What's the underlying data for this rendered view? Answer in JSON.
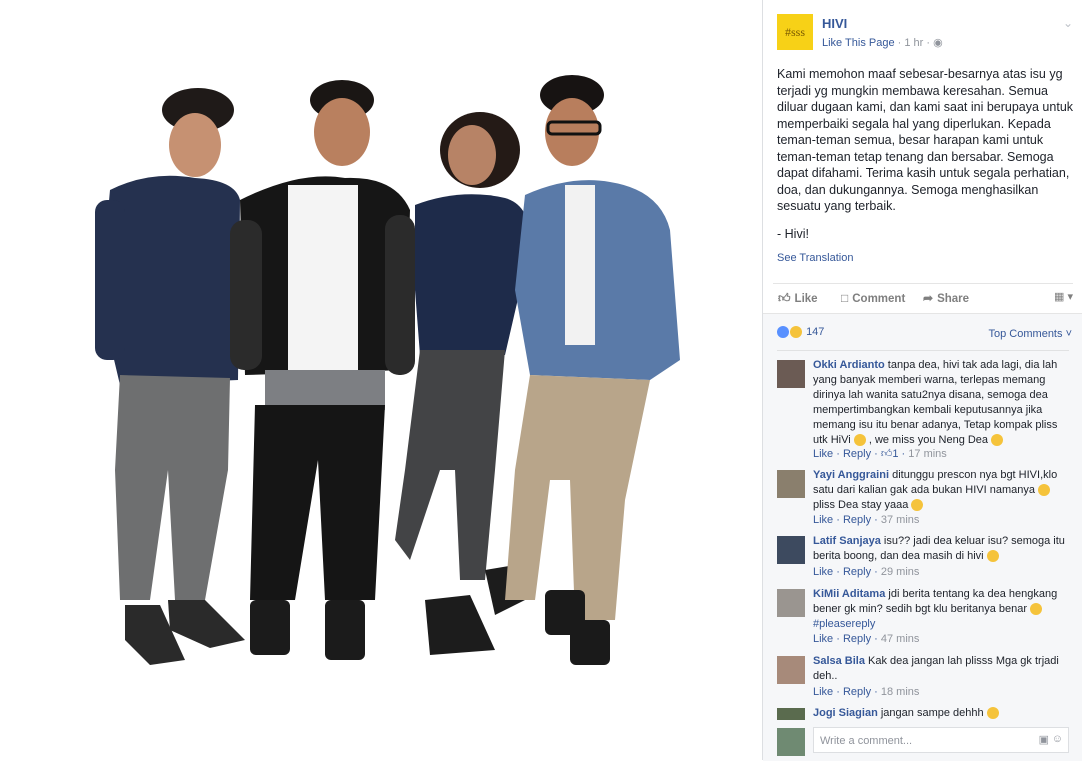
{
  "post": {
    "page_name": "HIVI",
    "logo_text": "#sss",
    "like_page_label": "Like This Page",
    "time": "1 hr",
    "paragraphs": [
      "Kami memohon maaf sebesar-besarnya atas isu yg terjadi yg mungkin membawa keresahan. Semua diluar dugaan kami, dan kami saat ini berupaya untuk memperbaiki segala hal yang diperlukan. Kepada teman-teman semua, besar harapan kami untuk teman-teman tetap tenang dan bersabar. Semoga dapat difahami. Terima kasih untuk segala perhatian, doa, dan dukungannya. Semoga menghasilkan sesuatu yang terbaik.",
      "- Hivi!"
    ],
    "see_translation": "See Translation"
  },
  "actions": {
    "like": "Like",
    "comment": "Comment",
    "share": "Share"
  },
  "reactions": {
    "count": "147",
    "colors": [
      "#5890ff",
      "#f5c33b"
    ]
  },
  "top_comments_label": "Top Comments",
  "comments": [
    {
      "name": "Okki Ardianto",
      "text": "tanpa dea, hivi tak ada lagi, dia lah yang banyak memberi warna, terlepas memang dirinya lah wanita satu2nya disana, semoga dea mempertimbangkan kembali keputusannya jika memang isu itu benar adanya, Tetap kompak pliss utk HiVi",
      "text_end": ", we miss you Neng Dea",
      "like": "Like",
      "reply": "Reply",
      "likes_count": "1",
      "time": "17 mins"
    },
    {
      "name": "Yayi Anggraini",
      "text": "ditunggu prescon nya bgt HIVI,klo satu dari kalian gak ada bukan HIVI namanya",
      "text_end": "pliss Dea stay yaaa",
      "like": "Like",
      "reply": "Reply",
      "time": "37 mins"
    },
    {
      "name": "Latif Sanjaya",
      "text": "isu?? jadi dea keluar isu? semoga itu berita boong, dan dea masih di hivi",
      "like": "Like",
      "reply": "Reply",
      "time": "29 mins"
    },
    {
      "name": "KiMii Aditama",
      "text": "jdi berita tentang ka dea hengkang bener gk min? sedih bgt klu beritanya benar",
      "hashtag": "#pleasereply",
      "like": "Like",
      "reply": "Reply",
      "time": "47 mins"
    },
    {
      "name": "Salsa Bila",
      "text": "Kak dea jangan lah plisss Mga gk trjadi deh..",
      "like": "Like",
      "reply": "Reply",
      "time": "18 mins"
    },
    {
      "name": "Jogi Siagian",
      "text": "jangan sampe dehhh"
    }
  ],
  "write_comment_placeholder": "Write a comment..."
}
